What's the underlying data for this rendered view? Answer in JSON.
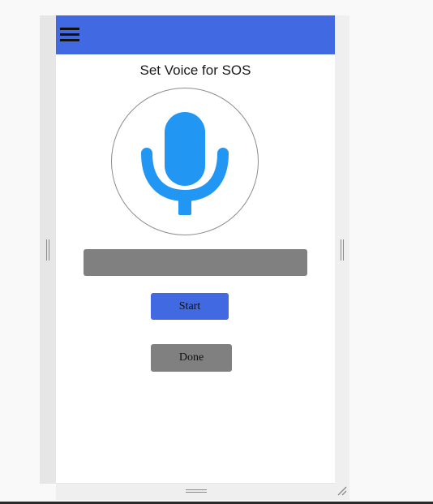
{
  "app_bar": {
    "menu_icon": "hamburger-menu-icon",
    "color": "#4169e1"
  },
  "page": {
    "title": "Set Voice for SOS"
  },
  "mic": {
    "icon": "microphone-icon",
    "color": "#2196f3"
  },
  "voice_input": {
    "value": ""
  },
  "buttons": {
    "start_label": "Start",
    "done_label": "Done"
  },
  "colors": {
    "primary": "#4169e1",
    "neutral": "#808080",
    "mic": "#2196f3"
  }
}
